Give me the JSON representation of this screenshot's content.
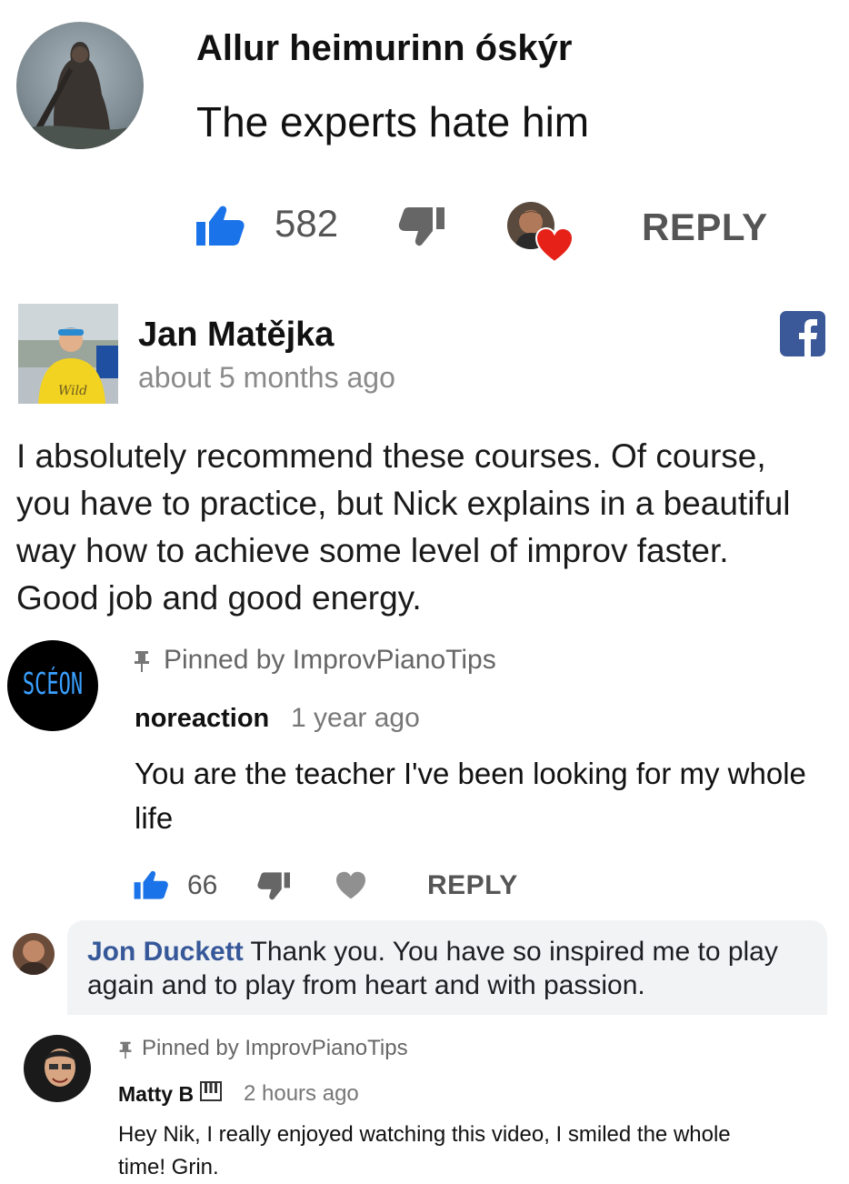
{
  "comment1": {
    "author": "Allur heimurinn óskýr",
    "text": "The experts hate him",
    "likes": "582",
    "reply_label": "REPLY",
    "avatar_icon": "warrior-avatar-icon",
    "like_color": "#1a73e8",
    "heart_color": "#e62117"
  },
  "comment2": {
    "author": "Jan Matějka",
    "time": "about 5 months ago",
    "text_lines": [
      "I absolutely recommend these courses. Of course,",
      "you have to practice, but Nick explains in a beautiful",
      "way how to achieve some level of improv faster.",
      "Good job and good energy."
    ],
    "platform_icon": "facebook-icon",
    "facebook_color": "#3b5998",
    "avatar_shirt_text": "Wild"
  },
  "comment3": {
    "pinned_label": "Pinned by ImprovPianoTips",
    "author": "noreaction",
    "time": "1 year ago",
    "text_lines": [
      "You are the teacher I've been looking for my whole",
      "life"
    ],
    "likes": "66",
    "reply_label": "REPLY",
    "avatar_text": "SCÉON",
    "reply_comment": {
      "author": "Jon Duckett",
      "text_line1": "Thank you. You have so inspired me to play",
      "text_line2": "again and to play from heart and with passion.",
      "author_color": "#365899",
      "bubble_color": "#f2f3f5"
    }
  },
  "comment4": {
    "pinned_label": "Pinned by ImprovPianoTips",
    "author": "Matty B",
    "badge_icon": "piano-icon",
    "time": "2 hours ago",
    "text_lines": [
      "Hey Nik, I really enjoyed watching this video, I smiled the whole",
      "time!  Grin."
    ]
  }
}
